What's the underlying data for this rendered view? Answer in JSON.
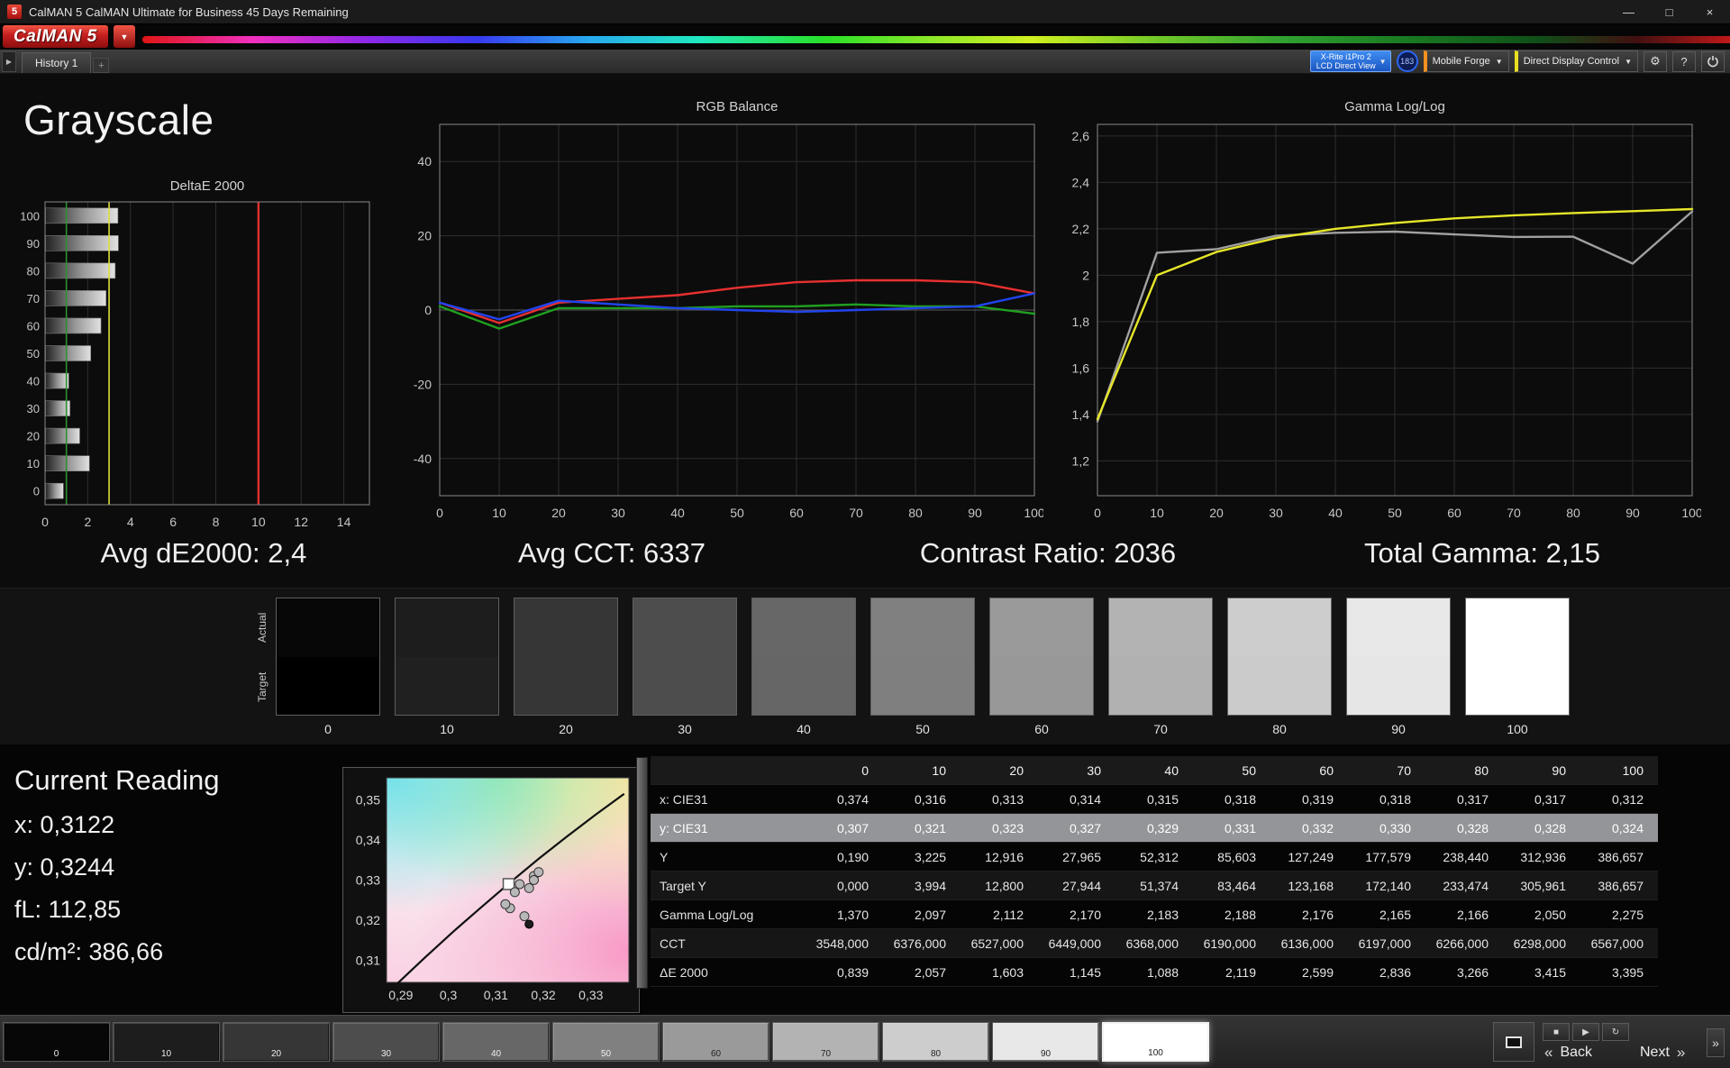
{
  "titlebar": {
    "title": "CalMAN 5 CalMAN Ultimate for Business 45 Days Remaining",
    "icon_text": "5",
    "minimize": "—",
    "maximize": "□",
    "close": "×"
  },
  "logo": {
    "text": "CalMAN 5",
    "caret": "▼"
  },
  "toolbar": {
    "expander": "▶",
    "history_tab": "History 1",
    "new_tab": "+",
    "meter": {
      "line1": "X-Rite i1Pro 2",
      "line2": "LCD Direct View",
      "caret": "▼"
    },
    "badge": "183",
    "source": {
      "label": "Mobile Forge",
      "caret": "▼",
      "accent": "#f09020"
    },
    "display_control": {
      "label": "Direct Display Control",
      "caret": "▼",
      "accent": "#e8e020"
    },
    "gear": "⚙",
    "help": "?"
  },
  "page_title": "Grayscale",
  "stats": [
    {
      "text": "Avg dE2000: 2,4"
    },
    {
      "text": "Avg CCT: 6337"
    },
    {
      "text": "Contrast Ratio: 2036"
    },
    {
      "text": "Total Gamma: 2,15"
    }
  ],
  "chart_data": [
    {
      "id": "deltae",
      "type": "bar",
      "orientation": "horizontal",
      "title": "DeltaE 2000",
      "categories": [
        "100",
        "90",
        "80",
        "70",
        "60",
        "50",
        "40",
        "30",
        "20",
        "10",
        "0"
      ],
      "values": [
        3.395,
        3.415,
        3.266,
        2.836,
        2.599,
        2.119,
        1.088,
        1.145,
        1.603,
        2.057,
        0.839
      ],
      "xlim": [
        0,
        15.2
      ],
      "xticks": [
        0,
        2,
        4,
        6,
        8,
        10,
        12,
        14
      ],
      "ref_lines": [
        {
          "value": 1.0,
          "color": "#2f8f2f",
          "width": 1.6
        },
        {
          "value": 3.0,
          "color": "#dede3a",
          "width": 1.6
        },
        {
          "value": 10.0,
          "color": "#e03030",
          "width": 2.4
        }
      ]
    },
    {
      "id": "rgb-balance",
      "type": "line",
      "title": "RGB Balance",
      "x": [
        0,
        10,
        20,
        30,
        40,
        50,
        60,
        70,
        80,
        90,
        100
      ],
      "ylim": [
        -50,
        50
      ],
      "yticks": [
        40,
        20,
        0,
        -20,
        -40
      ],
      "xticks": [
        0,
        10,
        20,
        30,
        40,
        50,
        60,
        70,
        80,
        90,
        100
      ],
      "series": [
        {
          "name": "red",
          "color": "#e83030",
          "values": [
            2,
            -3.5,
            2,
            3,
            4,
            6,
            7.5,
            8,
            8,
            7.5,
            4.5
          ]
        },
        {
          "name": "green",
          "color": "#20a020",
          "values": [
            1,
            -5,
            0.5,
            0.5,
            0.5,
            1,
            1,
            1.5,
            1,
            1,
            -1
          ]
        },
        {
          "name": "blue",
          "color": "#2244ee",
          "values": [
            2,
            -2.5,
            2.5,
            1.5,
            0.5,
            0,
            -0.5,
            0,
            0.5,
            1,
            4.5
          ]
        }
      ]
    },
    {
      "id": "gamma",
      "type": "line",
      "title": "Gamma Log/Log",
      "x": [
        0,
        10,
        20,
        30,
        40,
        50,
        60,
        70,
        80,
        90,
        100
      ],
      "ylim": [
        1.05,
        2.65
      ],
      "yticks": [
        2.6,
        2.4,
        2.2,
        2.0,
        1.8,
        1.6,
        1.4,
        1.2
      ],
      "ytick_labels": [
        "2,6",
        "2,4",
        "2,2",
        "2",
        "1,8",
        "1,6",
        "1,4",
        "1,2"
      ],
      "xticks": [
        0,
        10,
        20,
        30,
        40,
        50,
        60,
        70,
        80,
        90,
        100
      ],
      "series": [
        {
          "name": "measured",
          "color": "#a0a0a0",
          "values": [
            1.37,
            2.097,
            2.112,
            2.17,
            2.183,
            2.188,
            2.176,
            2.165,
            2.166,
            2.05,
            2.275
          ]
        },
        {
          "name": "target",
          "color": "#e6e62a",
          "values": [
            1.38,
            2.0,
            2.1,
            2.16,
            2.2,
            2.225,
            2.245,
            2.258,
            2.268,
            2.276,
            2.285
          ]
        }
      ]
    },
    {
      "id": "cie",
      "type": "scatter",
      "title": "",
      "xlim": [
        0.287,
        0.338
      ],
      "ylim": [
        0.3045,
        0.3555
      ],
      "xticks": [
        0.29,
        0.3,
        0.31,
        0.32,
        0.33
      ],
      "xtick_labels": [
        "0,29",
        "0,3",
        "0,31",
        "0,32",
        "0,33"
      ],
      "yticks": [
        0.31,
        0.32,
        0.33,
        0.34,
        0.35
      ],
      "ytick_labels": [
        "0,31",
        "0,32",
        "0,33",
        "0,34",
        "0,35"
      ],
      "points": [
        [
          0.316,
          0.321
        ],
        [
          0.313,
          0.323
        ],
        [
          0.314,
          0.327
        ],
        [
          0.315,
          0.329
        ],
        [
          0.318,
          0.331
        ],
        [
          0.319,
          0.332
        ],
        [
          0.318,
          0.33
        ],
        [
          0.317,
          0.328
        ],
        [
          0.312,
          0.324
        ]
      ],
      "dark_point": [
        0.317,
        0.319
      ],
      "target_marker": [
        0.3127,
        0.329
      ],
      "locus": [
        [
          0.289,
          0.3039
        ],
        [
          0.295,
          0.3106
        ],
        [
          0.301,
          0.3171
        ],
        [
          0.307,
          0.3233
        ],
        [
          0.313,
          0.3294
        ],
        [
          0.319,
          0.3353
        ],
        [
          0.325,
          0.3409
        ],
        [
          0.331,
          0.3463
        ],
        [
          0.337,
          0.3515
        ]
      ]
    }
  ],
  "swatches": {
    "actual_label": "Actual",
    "target_label": "Target",
    "items": [
      {
        "label": "0",
        "actual": "#070707",
        "target": "#000000"
      },
      {
        "label": "10",
        "actual": "#1d1d1d",
        "target": "#202020"
      },
      {
        "label": "20",
        "actual": "#363636",
        "target": "#363636"
      },
      {
        "label": "30",
        "actual": "#4d4d4d",
        "target": "#4d4d4d"
      },
      {
        "label": "40",
        "actual": "#676767",
        "target": "#666666"
      },
      {
        "label": "50",
        "actual": "#808080",
        "target": "#7f7f7f"
      },
      {
        "label": "60",
        "actual": "#9a9a9a",
        "target": "#989898"
      },
      {
        "label": "70",
        "actual": "#b3b3b3",
        "target": "#b1b1b1"
      },
      {
        "label": "80",
        "actual": "#cdcdcd",
        "target": "#cbcbcb"
      },
      {
        "label": "90",
        "actual": "#e8e8e8",
        "target": "#e6e6e6"
      },
      {
        "label": "100",
        "actual": "#ffffff",
        "target": "#ffffff"
      }
    ]
  },
  "current_reading": {
    "title": "Current Reading",
    "lines": [
      "x: 0,3122",
      "y: 0,3244",
      "fL: 112,85",
      "cd/m²: 386,66"
    ]
  },
  "table": {
    "columns": [
      "0",
      "10",
      "20",
      "30",
      "40",
      "50",
      "60",
      "70",
      "80",
      "90",
      "100"
    ],
    "rows": [
      {
        "label": "x: CIE31",
        "highlight": false,
        "values": [
          "0,374",
          "0,316",
          "0,313",
          "0,314",
          "0,315",
          "0,318",
          "0,319",
          "0,318",
          "0,317",
          "0,317",
          "0,312"
        ]
      },
      {
        "label": "y: CIE31",
        "highlight": true,
        "values": [
          "0,307",
          "0,321",
          "0,323",
          "0,327",
          "0,329",
          "0,331",
          "0,332",
          "0,330",
          "0,328",
          "0,328",
          "0,324"
        ]
      },
      {
        "label": "Y",
        "highlight": false,
        "values": [
          "0,190",
          "3,225",
          "12,916",
          "27,965",
          "52,312",
          "85,603",
          "127,249",
          "177,579",
          "238,440",
          "312,936",
          "386,657"
        ]
      },
      {
        "label": "Target Y",
        "highlight": false,
        "values": [
          "0,000",
          "3,994",
          "12,800",
          "27,944",
          "51,374",
          "83,464",
          "123,168",
          "172,140",
          "233,474",
          "305,961",
          "386,657"
        ]
      },
      {
        "label": "Gamma Log/Log",
        "highlight": false,
        "values": [
          "1,370",
          "2,097",
          "2,112",
          "2,170",
          "2,183",
          "2,188",
          "2,176",
          "2,165",
          "2,166",
          "2,050",
          "2,275"
        ]
      },
      {
        "label": "CCT",
        "highlight": false,
        "values": [
          "3548,000",
          "6376,000",
          "6527,000",
          "6449,000",
          "6368,000",
          "6190,000",
          "6136,000",
          "6197,000",
          "6266,000",
          "6298,000",
          "6567,000"
        ]
      },
      {
        "label": "ΔE 2000",
        "highlight": false,
        "values": [
          "0,839",
          "2,057",
          "1,603",
          "1,145",
          "1,088",
          "2,119",
          "2,599",
          "2,836",
          "3,266",
          "3,415",
          "3,395"
        ]
      }
    ]
  },
  "pattern_bar": {
    "selected": "100",
    "items": [
      {
        "label": "0",
        "color": "#070707"
      },
      {
        "label": "10",
        "color": "#1d1d1d"
      },
      {
        "label": "20",
        "color": "#363636"
      },
      {
        "label": "30",
        "color": "#4d4d4d"
      },
      {
        "label": "40",
        "color": "#676767"
      },
      {
        "label": "50",
        "color": "#808080"
      },
      {
        "label": "60",
        "color": "#9a9a9a"
      },
      {
        "label": "70",
        "color": "#b3b3b3"
      },
      {
        "label": "80",
        "color": "#cdcdcd"
      },
      {
        "label": "90",
        "color": "#e8e8e8"
      },
      {
        "label": "100",
        "color": "#ffffff"
      }
    ],
    "mini_buttons": [
      "■",
      "▶",
      "↻"
    ],
    "back_icon": "«",
    "back": "Back",
    "next": "Next",
    "next_icon": "»",
    "ff": "»"
  }
}
